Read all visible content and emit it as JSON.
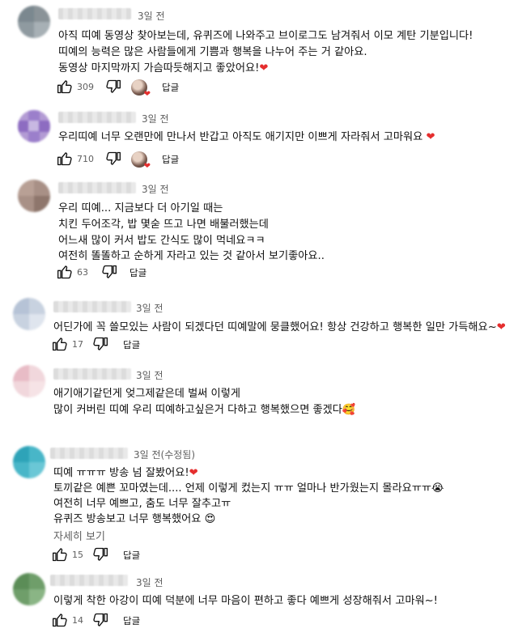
{
  "comments": [
    {
      "time": "3일 전",
      "lines": [
        "아직 띠예 동영상 찾아보는데, 유퀴즈에 나와주고 브이로그도 남겨줘서 이모 계탄 기분입니다!",
        "띠예의 능력은 많은 사람들에게 기쁨과 행복을 나누어 주는 거 같아요.",
        "동영상 마지막까지 가슴따듯해지고 좋았어요!"
      ],
      "likes": "309",
      "reply": "답글"
    },
    {
      "time": "3일 전",
      "lines": [
        "우리띠예 너무 오랜만에 만나서 반갑고 아직도 애기지만 이쁘게 자라줘서 고마워요"
      ],
      "likes": "710",
      "reply": "답글"
    },
    {
      "time": "3일 전",
      "lines": [
        "우리 띠예... 지금보다 더 아기일 때는",
        "치킨 두어조각, 밥 몇숟 뜨고 나면 배불러했는데",
        "어느새 많이 커서 밥도 간식도 많이 먹네요ㅋㅋ",
        "여전히 똘똘하고 순하게 자라고 있는 것 같아서 보기좋아요.."
      ],
      "likes": "63",
      "reply": "답글"
    },
    {
      "time": "3일 전",
      "lines": [
        "어딘가에 꼭 쓸모있는 사람이 되겠다던 띠예말에 뭉클했어요! 항상 건강하고 행복한 일만 가득해요~"
      ],
      "likes": "17",
      "reply": "답글"
    },
    {
      "time": "3일 전",
      "lines": [
        "애기애기같던게 엊그제같은데 벌써 이렇게",
        "많이 커버린 띠예 우리 띠예하고싶은거 다하고 행복했으면 좋겠다"
      ],
      "likes": "",
      "reply": ""
    },
    {
      "time": "3일 전(수정됨)",
      "lines": [
        "띠예 ㅠㅠㅠ 방송 넘 잘봤어요!",
        "토끼같은 예쁜 꼬마였는데.... 언제 이렇게 컸는지 ㅠㅠ 얼마나 반가웠는지 몰라요ㅠㅠ",
        "여전히 너무 예쁘고, 춤도 너무 잘추고ㅠ",
        "유퀴즈 방송보고 너무 행복했어요"
      ],
      "more": "자세히 보기",
      "likes": "15",
      "reply": "답글"
    },
    {
      "time": "3일 전",
      "lines": [
        "이렇게 착한 아강이 띠예 덕분에 너무 마음이 편하고 좋다 예쁘게 성장해줘서 고마워~!"
      ],
      "likes": "14",
      "reply": "답글"
    }
  ],
  "icons": {
    "heart": "❤",
    "pink_heart": "💗",
    "rabbit": "🐰",
    "crying": "😭",
    "hearts_face": "🥰",
    "heart_eyes": "😍"
  },
  "colors": {
    "text": "#0f0f0f",
    "meta": "#606060",
    "heart": "#e52e2e"
  }
}
